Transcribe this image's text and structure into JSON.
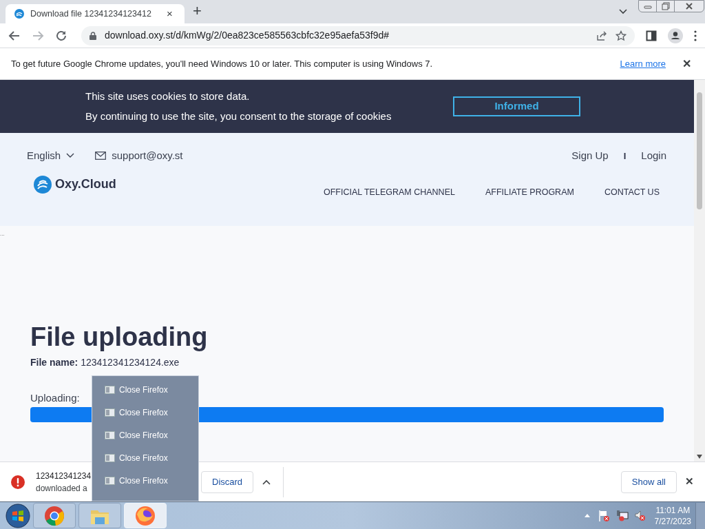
{
  "browser": {
    "tab": {
      "title": "Download file 12341234123412",
      "close": "×"
    },
    "new_tab": "+",
    "url": "download.oxy.st/d/kmWg/2/0ea823ce585563cbfc32e95aefa53f9d#"
  },
  "infobar": {
    "message": "To get future Google Chrome updates, you'll need Windows 10 or later. This computer is using Windows 7.",
    "link": "Learn more",
    "close": "✕"
  },
  "cookie_banner": {
    "lines": [
      "This site uses cookies to store data.",
      "By continuing to use the site, you consent to the storage of cookies"
    ],
    "button": "Informed"
  },
  "header": {
    "language": "English",
    "email": "support@oxy.st",
    "sign_up": "Sign Up",
    "separator": "I",
    "login": "Login",
    "logo": "Oxy.Cloud",
    "nav": [
      "OFFICIAL TELEGRAM CHANNEL",
      "AFFILIATE PROGRAM",
      "CONTACT US"
    ]
  },
  "content": {
    "marker": "...",
    "title": "File uploading",
    "file_name": "**File name:** 123412341234124.exe",
    "progress_label": "Uploading:",
    "progress": {
      "level": 1
    }
  },
  "download_shelf": {
    "item": {
      "name": "123412341234",
      "status": "downloaded a"
    },
    "discard": "Discard",
    "show_all": "Show all",
    "close": "✕"
  },
  "jump_list": {
    "items": [
      {
        "label": "Close Firefox"
      },
      {
        "label": "Close Firefox"
      },
      {
        "label": "Close Firefox"
      },
      {
        "label": "Close Firefox"
      },
      {
        "label": "Close Firefox"
      }
    ]
  },
  "taskbar": {
    "apps": [
      {
        "kind": "chrome",
        "selected": false
      },
      {
        "kind": "explorer",
        "selected": false
      },
      {
        "kind": "firefox",
        "selected": true
      }
    ],
    "time": "11:01 AM",
    "date": "7/27/2023"
  }
}
